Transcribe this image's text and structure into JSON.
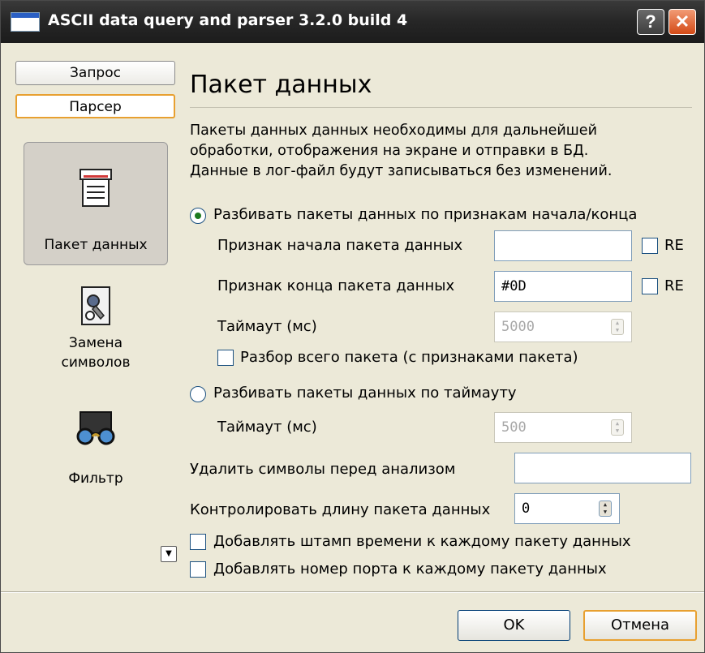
{
  "window": {
    "title": "ASCII data query and parser 3.2.0 build 4",
    "help_label": "?",
    "close_label": "✕"
  },
  "sidebar": {
    "tabs": [
      {
        "label": "Запрос",
        "active": false
      },
      {
        "label": "Парсер",
        "active": true
      }
    ],
    "items": [
      {
        "label": "Пакет данных",
        "icon": "packet-icon",
        "selected": true
      },
      {
        "label": "Замена символов",
        "icon": "replace-symbols-icon",
        "selected": false
      },
      {
        "label": "Фильтр",
        "icon": "filter-glasses-icon",
        "selected": false
      }
    ],
    "scroll_down_icon": "scroll-down-icon"
  },
  "main": {
    "heading": "Пакет данных",
    "description": [
      "Пакеты данных данных необходимы для дальнейшей",
      "обработки, отображения на экране и отправки в БД.",
      "Данные в лог-файл будут записываться без изменений."
    ],
    "mode_markers": {
      "label": "Разбивать пакеты данных по признакам начала/конца",
      "checked": true,
      "start_label": "Признак начала пакета данных",
      "start_value": "",
      "start_re_label": "RE",
      "start_re_checked": false,
      "end_label": "Признак конца пакета данных",
      "end_value": "#0D",
      "end_re_label": "RE",
      "end_re_checked": false,
      "timeout_label": "Таймаут (мс)",
      "timeout_value": "5000",
      "full_parse_label": "Разбор всего пакета (с признаками пакета)",
      "full_parse_checked": false
    },
    "mode_timeout": {
      "label": "Разбивать пакеты данных по таймауту",
      "checked": false,
      "timeout_label": "Таймаут (мс)",
      "timeout_value": "500"
    },
    "remove_chars_label": "Удалить символы перед анализом",
    "remove_chars_value": "",
    "check_length_label": "Контролировать длину пакета данных",
    "check_length_value": "0",
    "add_timestamp_label": "Добавлять штамп времени к каждому пакету данных",
    "add_timestamp_checked": false,
    "add_port_label": "Добавлять номер порта к каждому пакету данных",
    "add_port_checked": false
  },
  "footer": {
    "ok_label": "OK",
    "cancel_label": "Отмена"
  },
  "colors": {
    "titlebar": "#262626",
    "dialog_bg": "#ece9d8",
    "focus_accent": "#e8a030",
    "close_button": "#d44a16"
  }
}
